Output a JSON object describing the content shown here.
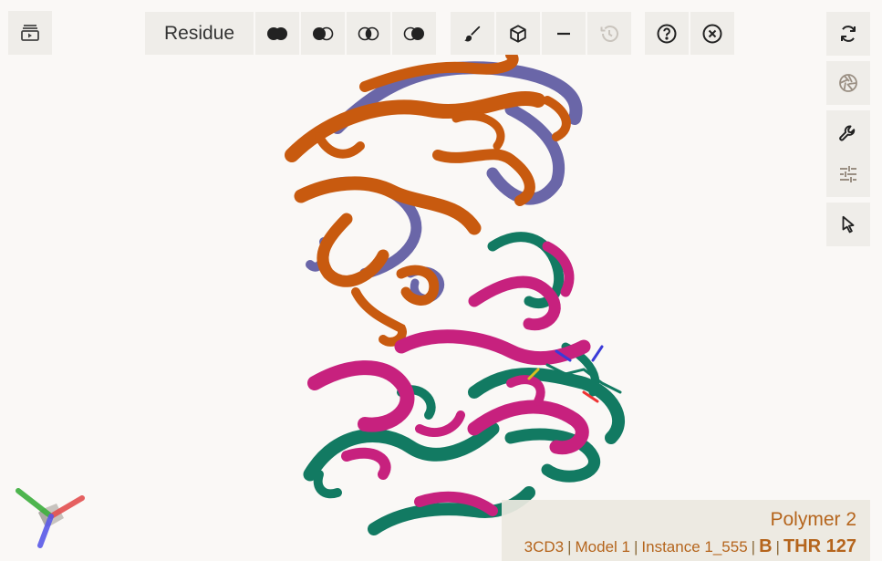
{
  "toolbar": {
    "residue_label": "Residue",
    "buttons": [
      "expand-viewport-icon",
      "color-scheme-all-icon",
      "color-scheme-left-icon",
      "color-scheme-overlap-icon",
      "color-scheme-right-icon",
      "brush-icon",
      "cube-icon",
      "minus-icon",
      "history-icon",
      "help-icon",
      "close-circle-icon"
    ]
  },
  "side_controls": [
    "reset-rotate-icon",
    "camera-shutter-icon",
    "wrench-icon",
    "sliders-icon",
    "cursor-icon"
  ],
  "structure": {
    "colors": {
      "chain_a_orange": "#c85a0f",
      "chain_a_purple": "#6a66a8",
      "chain_b_magenta": "#c7217e",
      "chain_b_teal": "#127a62"
    }
  },
  "info": {
    "title": "Polymer 2",
    "entry": "3CD3",
    "model": "Model 1",
    "instance": "Instance 1_555",
    "chain": "B",
    "residue": "THR 127"
  },
  "axes_colors": {
    "x": "#e35050",
    "y": "#3cae3c",
    "z": "#5a5ae8"
  }
}
